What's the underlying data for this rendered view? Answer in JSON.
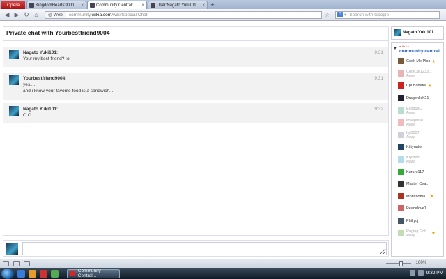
{
  "browser": {
    "menu_label": "Opera",
    "tabs": [
      {
        "label": "KingdomHearts3D:DD..."
      },
      {
        "label": "Community Central: W..."
      },
      {
        "label": "User:Nagato Yuki101 - ..."
      }
    ],
    "new_tab": "+",
    "web_badge": "Web",
    "address_prefix": "community.",
    "address_host": "wikia.com",
    "address_path": "/wiki/Special:Chat",
    "search_placeholder": "Search with Google"
  },
  "chat": {
    "title": "Private chat with Yourbestfriend9004",
    "self_user": "Nagato Yuki101",
    "messages": [
      {
        "name": "Nagato Yuki101:",
        "lines": [
          "Your my best friend? :o"
        ],
        "time": "9:31"
      },
      {
        "name": "Yourbestfriend9004:",
        "lines": [
          "yes....",
          "and i know your favorite food is a sandwich..."
        ],
        "time": "9:31"
      },
      {
        "name": "Nagato Yuki101:",
        "lines": [
          "O.O"
        ],
        "time": "9:32"
      }
    ],
    "input_value": ""
  },
  "userlist": {
    "wiki_name": "community central",
    "wiki_tag": "wikia",
    "users": [
      {
        "name": "Cook Me Plox",
        "away": false,
        "star": true,
        "color": "#7a5a3a"
      },
      {
        "name": "CoolCat1233...",
        "away": true,
        "star": false,
        "status": "Away",
        "color": "#c44"
      },
      {
        "name": "Cpl.Bohater",
        "away": false,
        "star": true,
        "color": "#c22"
      },
      {
        "name": "Dragonlich21",
        "away": false,
        "star": false,
        "color": "#223"
      },
      {
        "name": "ExodusC",
        "away": true,
        "star": false,
        "status": "Away",
        "color": "#5a8"
      },
      {
        "name": "ilovejesse",
        "away": true,
        "star": false,
        "status": "Away",
        "color": "#d55"
      },
      {
        "name": "Irp0007",
        "away": true,
        "star": false,
        "status": "Away",
        "color": "#88a"
      },
      {
        "name": "Kittynator",
        "away": false,
        "star": false,
        "color": "#246"
      },
      {
        "name": "Kryston",
        "away": true,
        "star": false,
        "status": "Away",
        "color": "#4ac"
      },
      {
        "name": "Kururu117",
        "away": false,
        "star": false,
        "color": "#3a3"
      },
      {
        "name": "Master Cea...",
        "away": false,
        "star": false,
        "color": "#333"
      },
      {
        "name": "Monchoma...",
        "away": false,
        "star": true,
        "color": "#a32"
      },
      {
        "name": "Peacelove1...",
        "away": false,
        "star": false,
        "color": "#c66"
      },
      {
        "name": "Phillycj",
        "away": false,
        "star": false,
        "color": "#456"
      },
      {
        "name": "Raging Goh...",
        "away": true,
        "star": true,
        "status": "Away",
        "color": "#6a4"
      }
    ]
  },
  "statusbar": {
    "zoom": "100%"
  },
  "taskbar": {
    "task_label": "Community Central...",
    "clock": "9:32 PM"
  }
}
